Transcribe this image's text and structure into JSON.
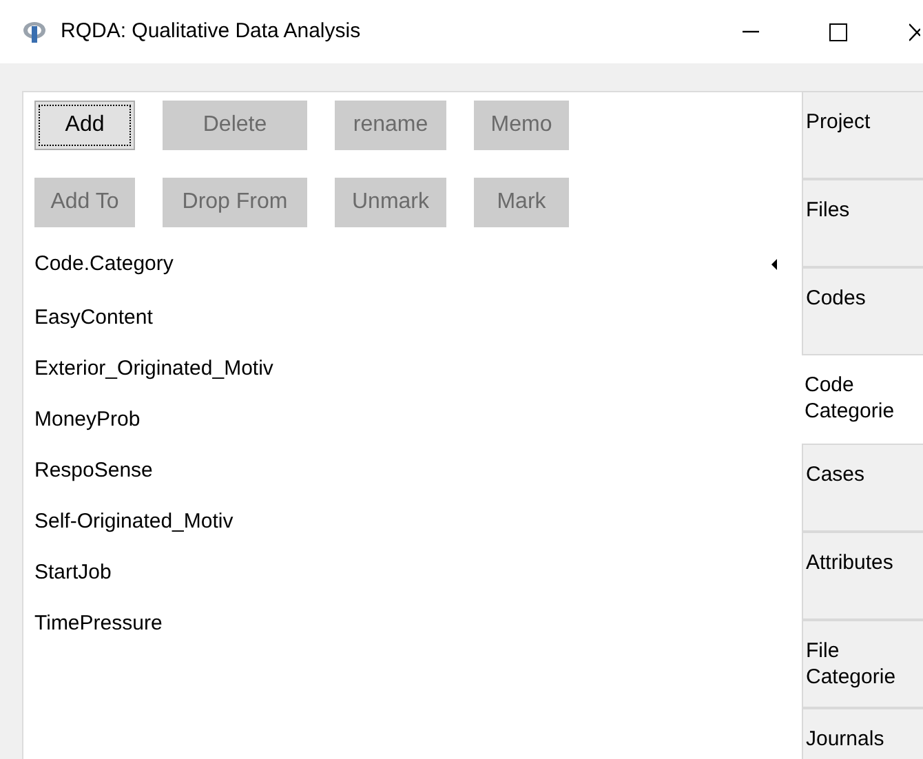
{
  "window": {
    "title": "RQDA: Qualitative Data Analysis"
  },
  "buttons": [
    {
      "label": "Add",
      "disabled": false,
      "focused": true
    },
    {
      "label": "Delete",
      "disabled": true,
      "focused": false
    },
    {
      "label": "rename",
      "disabled": true,
      "focused": false
    },
    {
      "label": "Memo",
      "disabled": true,
      "focused": false
    },
    {
      "label": "Add To",
      "disabled": true,
      "focused": false
    },
    {
      "label": "Drop From",
      "disabled": true,
      "focused": false
    },
    {
      "label": "Unmark",
      "disabled": true,
      "focused": false
    },
    {
      "label": "Mark",
      "disabled": true,
      "focused": false
    }
  ],
  "list": {
    "header": "Code.Category",
    "items": [
      "EasyContent",
      "Exterior_Originated_Motiv",
      "MoneyProb",
      "RespoSense",
      "Self-Originated_Motiv",
      "StartJob",
      "TimePressure"
    ]
  },
  "tabs": [
    {
      "label": "Project",
      "selected": false
    },
    {
      "label": "Files",
      "selected": false
    },
    {
      "label": "Codes",
      "selected": false
    },
    {
      "label": "Code Categorie",
      "selected": true
    },
    {
      "label": "Cases",
      "selected": false
    },
    {
      "label": "Attributes",
      "selected": false
    },
    {
      "label": "File Categorie",
      "selected": false
    },
    {
      "label": "Journals",
      "selected": false
    }
  ]
}
